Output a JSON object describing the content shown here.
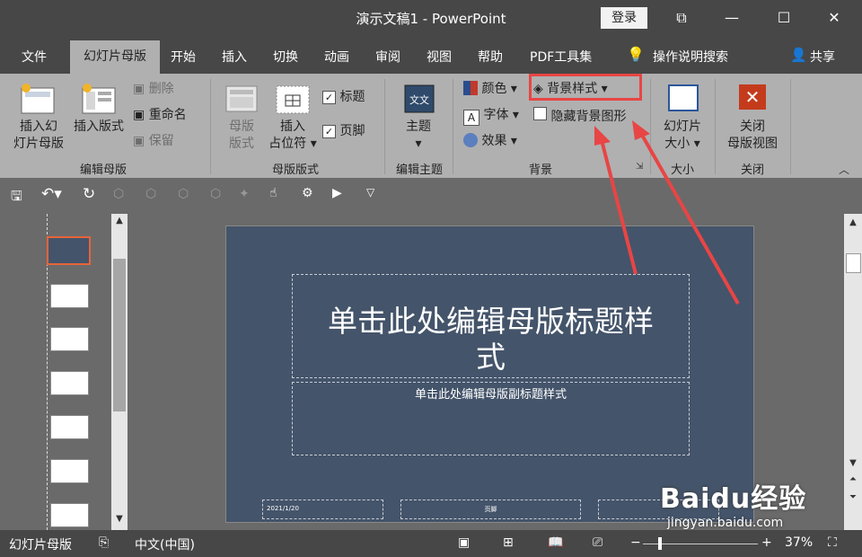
{
  "app": {
    "title": "演示文稿1  -  PowerPoint",
    "login_label": "登录"
  },
  "tabs": [
    "文件",
    "幻灯片母版",
    "开始",
    "插入",
    "切换",
    "动画",
    "审阅",
    "视图",
    "帮助",
    "PDF工具集"
  ],
  "tell_me": "操作说明搜索",
  "share": "共享",
  "ribbon": {
    "insert_slide_master": [
      "插入幻",
      "灯片母版"
    ],
    "insert_layout": "插入版式",
    "delete": "删除",
    "rename": "重命名",
    "preserve": "保留",
    "group_edit_master": "编辑母版",
    "master_layout": [
      "母版",
      "版式"
    ],
    "insert_placeholder": [
      "插入",
      "占位符"
    ],
    "title_check": "标题",
    "footer_check": "页脚",
    "group_master_layout": "母版版式",
    "themes": "主题",
    "group_edit_theme": "编辑主题",
    "colors": "颜色",
    "fonts": "字体",
    "effects": "效果",
    "background_styles": "背景样式",
    "hide_bg_graphics": "隐藏背景图形",
    "group_background": "背景",
    "slide_size": [
      "幻灯片",
      "大小"
    ],
    "group_size": "大小",
    "close_master": [
      "关闭",
      "母版视图"
    ],
    "group_close": "关闭"
  },
  "slide": {
    "title_line1": "单击此处编辑母版标题样",
    "title_line2": "式",
    "subtitle": "单击此处编辑母版副标题样式",
    "date": "2021/1/20",
    "footer": "页脚"
  },
  "status": {
    "view": "幻灯片母版",
    "language": "中文(中国)",
    "zoom": "37%",
    "zoom_level": 0.37
  },
  "watermark": {
    "brand": "Baidu经验",
    "url": "jingyan.baidu.com"
  },
  "colors": {
    "annotation_red": "#e84545",
    "slide_bg": "#44546a",
    "close_red": "#c43b1c"
  }
}
